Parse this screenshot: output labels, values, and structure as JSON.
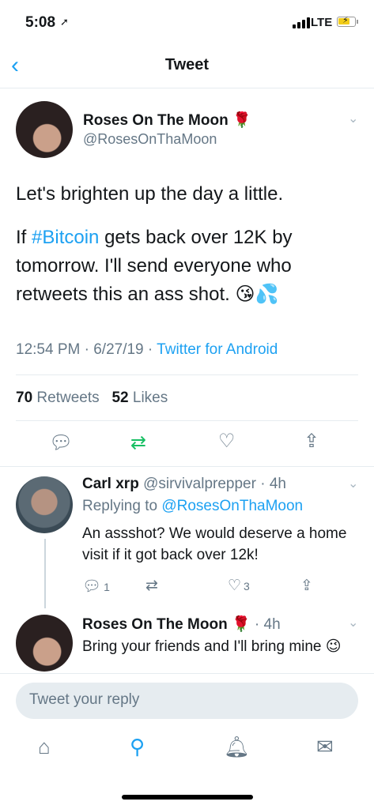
{
  "status_bar": {
    "time": "5:08",
    "network": "LTE"
  },
  "nav": {
    "title": "Tweet"
  },
  "tweet": {
    "author_name": "Roses On The Moon",
    "author_emoji": "🌹",
    "author_handle": "@RosesOnThaMoon",
    "line1": "Let's brighten up the day a little.",
    "line2_prefix": "If ",
    "line2_hashtag": "#Bitcoin",
    "line2_rest": " gets back over 12K by tomorrow. I'll send everyone who retweets this an ass shot. 😘💦",
    "time": "12:54 PM",
    "date": "6/27/19",
    "source": "Twitter for Android",
    "retweets_count": "70",
    "retweets_label": "Retweets",
    "likes_count": "52",
    "likes_label": "Likes"
  },
  "replies": [
    {
      "name": "Carl xrp",
      "handle": "@sirvivalprepper",
      "time": "4h",
      "replying_label": "Replying to",
      "replying_to": "@RosesOnThaMoon",
      "text": "An assshot? We would deserve a home visit if it got back over 12k!",
      "reply_count": "1",
      "like_count": "3"
    },
    {
      "name": "Roses On The Moon",
      "emoji": "🌹",
      "time": "4h",
      "text": "Bring your friends and I'll bring mine 😉"
    }
  ],
  "compose": {
    "placeholder": "Tweet your reply"
  },
  "tabs": [
    "home-icon",
    "search-icon",
    "bell-icon",
    "mail-icon"
  ],
  "colors": {
    "accent": "#1da1f2",
    "retweet": "#17bf63",
    "muted": "#657786"
  }
}
